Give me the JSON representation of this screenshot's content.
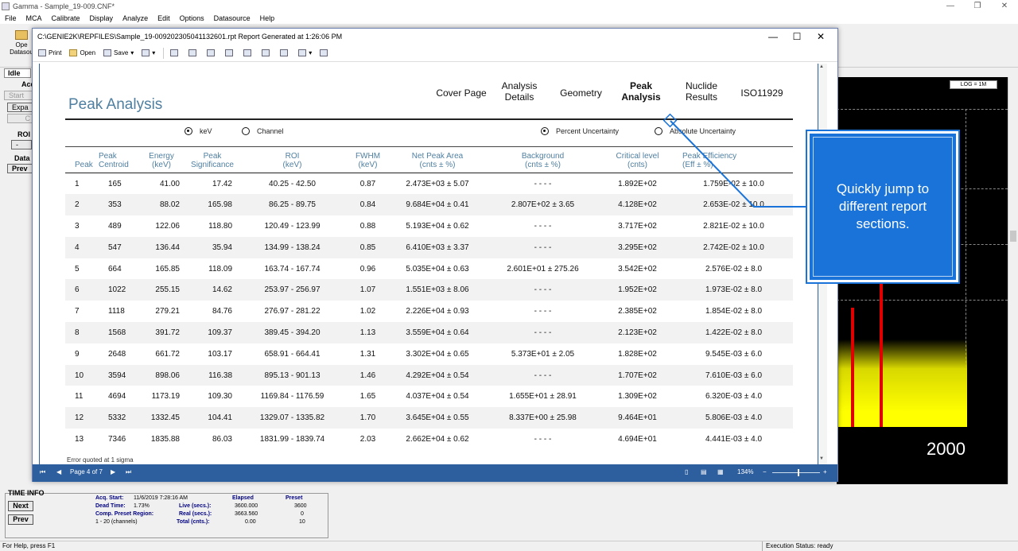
{
  "app": {
    "title": "Gamma - Sample_19-009.CNF*",
    "menu": [
      "File",
      "MCA",
      "Calibrate",
      "Display",
      "Analyze",
      "Edit",
      "Options",
      "Datasource",
      "Help"
    ],
    "open_datasource_label": "Ope\nDatasou",
    "window_controls": [
      "—",
      "❐",
      "✕"
    ]
  },
  "left_panel": {
    "status": "Idle",
    "acq_label": "Acq",
    "start_label": "Start",
    "expand_label": "Expa",
    "c_label": "C",
    "roi_label": "ROI",
    "roi_btn": "-",
    "data_label": "Data",
    "prev_label": "Prev"
  },
  "spectrum": {
    "log_label": "LOG = 1M",
    "axis_label": "2000",
    "fill_color": "#ffff00",
    "peak_color": "#e00000"
  },
  "report": {
    "window_title": "C:\\GENIE2K\\REPFILES\\Sample_19-009202305041132601.rpt Report Generated at 1:26:06 PM",
    "toolbar": {
      "print": "Print",
      "open": "Open",
      "save": "Save"
    },
    "section_title": "Peak Analysis",
    "nav": [
      {
        "label": "Cover Page",
        "active": false
      },
      {
        "label": "Analysis\nDetails",
        "active": false
      },
      {
        "label": "Geometry",
        "active": false
      },
      {
        "label": "Peak\nAnalysis",
        "active": true
      },
      {
        "label": "Nuclide\nResults",
        "active": false
      },
      {
        "label": "ISO11929",
        "active": false
      }
    ],
    "radios": {
      "kev": "keV",
      "channel": "Channel",
      "percent": "Percent Uncertainty",
      "absolute": "Absolute Uncertainty"
    },
    "columns": [
      "Peak",
      "Peak\nCentroid",
      "Energy\n(keV)",
      "Peak\nSignificance",
      "ROI\n(keV)",
      "FWHM\n(keV)",
      "Net Peak Area\n(cnts ± %)",
      "Background\n(cnts ± %)",
      "Critical level\n(cnts)",
      "Peak Efficiency\n(Eff ± %)"
    ],
    "rows": [
      [
        "1",
        "165",
        "41.00",
        "17.42",
        "40.25 - 42.50",
        "0.87",
        "2.473E+03  ± 5.07",
        "- - - -",
        "1.892E+02",
        "1.759E-02 ± 10.0"
      ],
      [
        "2",
        "353",
        "88.02",
        "165.98",
        "86.25 - 89.75",
        "0.84",
        "9.684E+04  ± 0.41",
        "2.807E+02  ±  3.65",
        "4.128E+02",
        "2.653E-02 ± 10.0"
      ],
      [
        "3",
        "489",
        "122.06",
        "118.80",
        "120.49 - 123.99",
        "0.88",
        "5.193E+04  ± 0.62",
        "- - - -",
        "3.717E+02",
        "2.821E-02 ± 10.0"
      ],
      [
        "4",
        "547",
        "136.44",
        "35.94",
        "134.99 - 138.24",
        "0.85",
        "6.410E+03  ± 3.37",
        "- - - -",
        "3.295E+02",
        "2.742E-02 ± 10.0"
      ],
      [
        "5",
        "664",
        "165.85",
        "118.09",
        "163.74 - 167.74",
        "0.96",
        "5.035E+04  ± 0.63",
        "2.601E+01  ±  275.26",
        "3.542E+02",
        "2.576E-02 ± 8.0"
      ],
      [
        "6",
        "1022",
        "255.15",
        "14.62",
        "253.97 - 256.97",
        "1.07",
        "1.551E+03  ± 8.06",
        "- - - -",
        "1.952E+02",
        "1.973E-02 ± 8.0"
      ],
      [
        "7",
        "1118",
        "279.21",
        "84.76",
        "276.97 - 281.22",
        "1.02",
        "2.226E+04  ± 0.93",
        "- - - -",
        "2.385E+02",
        "1.854E-02 ± 8.0"
      ],
      [
        "8",
        "1568",
        "391.72",
        "109.37",
        "389.45 - 394.20",
        "1.13",
        "3.559E+04  ± 0.64",
        "- - - -",
        "2.123E+02",
        "1.422E-02 ± 8.0"
      ],
      [
        "9",
        "2648",
        "661.72",
        "103.17",
        "658.91 - 664.41",
        "1.31",
        "3.302E+04  ± 0.65",
        "5.373E+01  ±  2.05",
        "1.828E+02",
        "9.545E-03 ± 6.0"
      ],
      [
        "10",
        "3594",
        "898.06",
        "116.38",
        "895.13 - 901.13",
        "1.46",
        "4.292E+04  ± 0.54",
        "- - - -",
        "1.707E+02",
        "7.610E-03 ± 6.0"
      ],
      [
        "11",
        "4694",
        "1173.19",
        "109.30",
        "1169.84 - 1176.59",
        "1.65",
        "4.037E+04  ± 0.54",
        "1.655E+01  ±  28.91",
        "1.309E+02",
        "6.320E-03 ± 4.0"
      ],
      [
        "12",
        "5332",
        "1332.45",
        "104.41",
        "1329.07 - 1335.82",
        "1.70",
        "3.645E+04  ± 0.55",
        "8.337E+00  ±  25.98",
        "9.464E+01",
        "5.806E-03 ± 4.0"
      ],
      [
        "13",
        "7346",
        "1835.88",
        "86.03",
        "1831.99 - 1839.74",
        "2.03",
        "2.662E+04  ± 0.62",
        "- - - -",
        "4.694E+01",
        "4.441E-03 ± 4.0"
      ]
    ],
    "footnote": "Error quoted at 1 sigma",
    "page_indicator": "Page 4 of 7",
    "zoom": "134%",
    "zoom_minus": "−",
    "zoom_plus": "+"
  },
  "callout": {
    "text": "Quickly jump to different report sections.",
    "color": "#1a73d8"
  },
  "time_info": {
    "title": "TIME INFO",
    "next": "Next",
    "prev": "Prev",
    "acq_start_label": "Acq. Start:",
    "acq_start_value": "11/6/2019   7:28:16 AM",
    "dead_time_label": "Dead Time:",
    "dead_time_value": "1.73%",
    "comp_label": "Comp. Preset Region:",
    "channels": "1 - 20 (channels)",
    "elapsed_header": "Elapsed",
    "preset_header": "Preset",
    "live_label": "Live (secs.):",
    "live_elapsed": "3600.000",
    "live_preset": "3600",
    "real_label": "Real (secs.):",
    "real_elapsed": "3663.560",
    "real_preset": "0",
    "total_label": "Total (cnts.):",
    "total_elapsed": "0.00",
    "total_preset": "10"
  },
  "status_bar": {
    "help": "For Help, press F1",
    "execution": "Execution Status: ready"
  }
}
